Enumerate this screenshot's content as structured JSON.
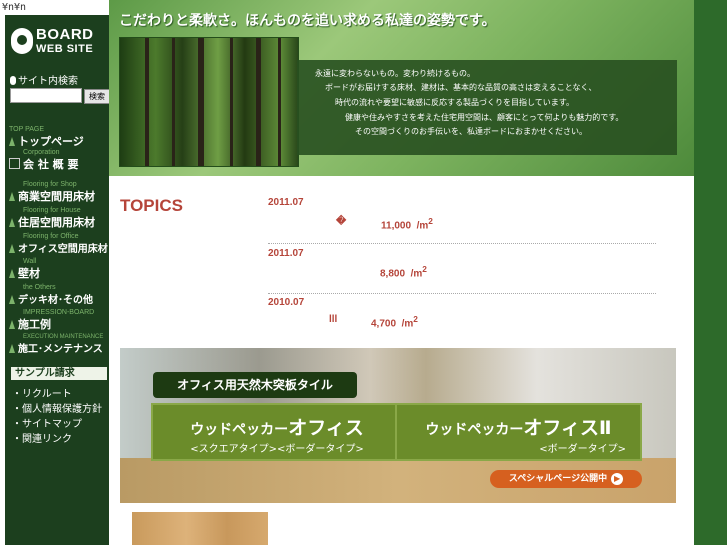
{
  "stray_text": "¥n¥n",
  "logo": {
    "line1": "BOARD",
    "line2": "WEB SITE"
  },
  "search": {
    "label": "サイト内検索",
    "value": "",
    "button": "検索"
  },
  "nav": [
    {
      "en": "TOP PAGE",
      "jp": "トップページ",
      "icon": "triangle-icon"
    },
    {
      "en": "Corporation",
      "jp": "会 社 概 要",
      "icon": "building-icon"
    },
    {
      "en": "Flooring for Shop",
      "jp": "商業空間用床材",
      "icon": "triangle-icon"
    },
    {
      "en": "Flooring for House",
      "jp": "住居空間用床材",
      "icon": "triangle-icon"
    },
    {
      "en": "Flooring for Office",
      "jp": "オフィス空間用床材",
      "icon": "triangle-icon"
    },
    {
      "en": "Wall",
      "jp": "壁材",
      "icon": "triangle-icon"
    },
    {
      "en": "the Others",
      "jp": "デッキ材･その他",
      "icon": "triangle-icon"
    },
    {
      "en": "IMPRESSION-BOARD",
      "jp": "施工例",
      "icon": "triangle-icon"
    },
    {
      "en": "EXECUTION MAINTENANCE",
      "jp": "施工･メンテナンス",
      "icon": "triangle-icon"
    }
  ],
  "sample_label": "サンプル請求",
  "links": [
    "リクルート",
    "個人情報保護方針",
    "サイトマップ",
    "関連リンク"
  ],
  "header": {
    "title": "こだわりと柔軟さ。ほんものを追い求める私達の姿勢です。",
    "message": [
      "永遠に変わらないもの。変わり続けるもの。",
      "ボードがお届けする床材、建材は、基本的な品質の高さは変えることなく、",
      "時代の流れや要望に敏感に反応する製品づくりを目指しています。",
      "健康や住みやすさを考えた住宅用空間は、顧客にとって何よりも魅力的です。",
      "その空間づくりのお手伝いを、私達ボードにおまかせください。"
    ]
  },
  "topics": {
    "heading": "TOPICS",
    "items": [
      {
        "date": "2011.07",
        "symbol": "�",
        "price": "11,000",
        "unit": "/m",
        "sup": "2"
      },
      {
        "date": "2011.07",
        "symbol": "",
        "price": "8,800",
        "unit": "/m",
        "sup": "2"
      },
      {
        "date": "2010.07",
        "symbol": "lll",
        "price": "4,700",
        "unit": "/m",
        "sup": "2"
      }
    ]
  },
  "promo": {
    "heading": "オフィス用天然木突板タイル",
    "card1": {
      "main": "ウッドペッカー",
      "big": "オフィス",
      "sub": "<スクエアタイプ><ボーダータイプ>"
    },
    "card2": {
      "main": "ウッドペッカー",
      "big": "オフィスⅡ",
      "sub": "<ボーダータイプ>"
    },
    "button": "スペシャルページ公開中",
    "button_arrow": "▶"
  },
  "colors": {
    "sidebar": "#1c3f1e",
    "accent": "#b5453a",
    "promo_green": "#6b8c2a",
    "button_orange": "#d6601f"
  }
}
